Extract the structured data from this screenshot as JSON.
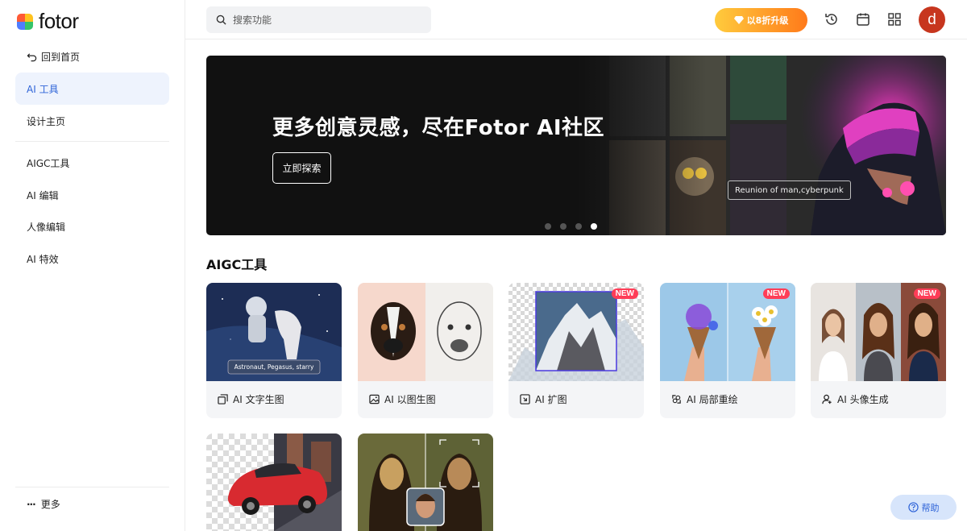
{
  "brand": {
    "name": "fotor"
  },
  "sidebar": {
    "back_label": "回到首页",
    "items": [
      {
        "label": "AI 工具",
        "active": true
      },
      {
        "label": "设计主页",
        "active": false
      },
      {
        "label": "AIGC工具",
        "active": false
      },
      {
        "label": "AI 编辑",
        "active": false
      },
      {
        "label": "人像编辑",
        "active": false
      },
      {
        "label": "AI 特效",
        "active": false
      }
    ],
    "more_label": "更多"
  },
  "header": {
    "search_placeholder": "搜索功能",
    "upgrade_label": "以8折升级",
    "icons": [
      "history-icon",
      "calendar-icon",
      "apps-grid-icon"
    ],
    "avatar_letter": "d"
  },
  "banner": {
    "title": "更多创意灵感，尽在Fotor AI社区",
    "button_label": "立即探索",
    "image_tag": "Reunion of man,cyberpunk",
    "slides": 4,
    "active_slide": 4
  },
  "section": {
    "title": "AIGC工具",
    "cards": [
      {
        "label": "AI 文字生图",
        "icon": "text-to-image-icon",
        "badge": "",
        "caption": "Astronaut, Pegasus, starry"
      },
      {
        "label": "AI 以图生图",
        "icon": "image-icon",
        "badge": ""
      },
      {
        "label": "AI 扩图",
        "icon": "expand-icon",
        "badge": "NEW"
      },
      {
        "label": "AI 局部重绘",
        "icon": "replace-icon",
        "badge": "NEW"
      },
      {
        "label": "AI 头像生成",
        "icon": "user-add-icon",
        "badge": "NEW"
      },
      {
        "label": "",
        "icon": "",
        "badge": ""
      },
      {
        "label": "",
        "icon": "",
        "badge": ""
      }
    ]
  },
  "help": {
    "label": "帮助"
  },
  "colors": {
    "accent": "#2f64d8",
    "upgrade_start": "#ffcb3d",
    "upgrade_end": "#ff7a1a",
    "new_badge": "#ff3d57",
    "avatar": "#c7361e"
  }
}
